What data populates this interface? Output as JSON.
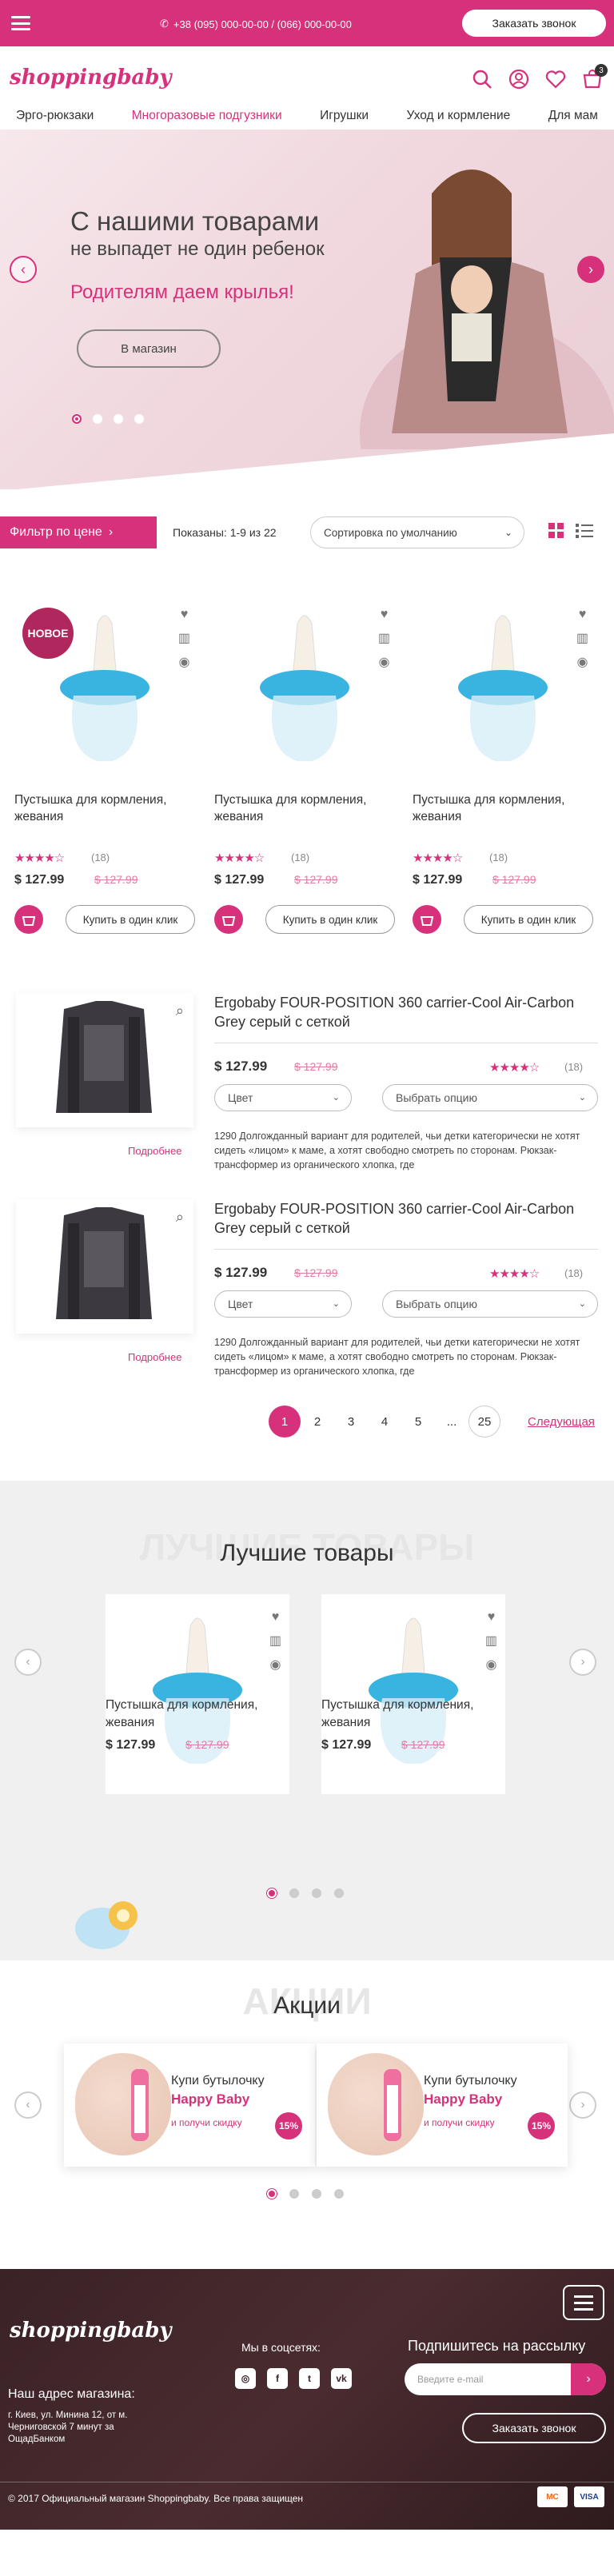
{
  "topbar": {
    "phones": "+38 (095) 000-00-00 / (066) 000-00-00",
    "call_button": "Заказать звонок"
  },
  "logo": "shoppingbaby",
  "header": {
    "cart_count": "3"
  },
  "nav": [
    "Эрго-рюкзаки",
    "Многоразовые подгузники",
    "Игрушки",
    "Уход и кормление",
    "Для мам"
  ],
  "hero": {
    "line1": "С нашими товарами",
    "line2": "не выпадет не один ребенок",
    "line3": "Родителям даем крылья!",
    "button": "В магазин"
  },
  "filter": {
    "button": "Фильтр по цене",
    "shown": "Показаны: 1-9 из 22",
    "sort": "Сортировка по умолчанию"
  },
  "products": [
    {
      "badge": "НОВОЕ",
      "name": "Пустышка для кормления, жевания",
      "stars": "★★★★☆",
      "count": "(18)",
      "price": "$ 127.99",
      "old": "$ 127.99",
      "buy": "Купить в один клик"
    },
    {
      "badge": "",
      "name": "Пустышка для кормления, жевания",
      "stars": "★★★★☆",
      "count": "(18)",
      "price": "$ 127.99",
      "old": "$ 127.99",
      "buy": "Купить в один клик"
    },
    {
      "badge": "",
      "name": "Пустышка для кормления, жевания",
      "stars": "★★★★☆",
      "count": "(18)",
      "price": "$ 127.99",
      "old": "$ 127.99",
      "buy": "Купить в один клик"
    }
  ],
  "list": [
    {
      "title": "Ergobaby FOUR-POSITION 360 carrier-Cool Air-Carbon Grey серый с сеткой",
      "price": "$ 127.99",
      "old": "$ 127.99",
      "stars": "★★★★☆",
      "count": "(18)",
      "color": "Цвет",
      "option": "Выбрать опцию",
      "desc": "1290 Долгожданный вариант для родителей, чьи детки категорически не хотят сидеть «лицом» к маме, а хотят свободно смотреть по сторонам. Рюкзак-трансформер из органического хлопка, где",
      "more": "Подробнее"
    },
    {
      "title": "Ergobaby FOUR-POSITION 360 carrier-Cool Air-Carbon Grey серый с сеткой",
      "price": "$ 127.99",
      "old": "$ 127.99",
      "stars": "★★★★☆",
      "count": "(18)",
      "color": "Цвет",
      "option": "Выбрать опцию",
      "desc": "1290 Долгожданный вариант для родителей, чьи детки категорически не хотят сидеть «лицом» к маме, а хотят свободно смотреть по сторонам. Рюкзак-трансформер из органического хлопка, где",
      "more": "Подробнее"
    }
  ],
  "pagination": {
    "pages": [
      "1",
      "2",
      "3",
      "4",
      "5",
      "...",
      "25"
    ],
    "next": "Следующая"
  },
  "best": {
    "ghost": "ЛУЧШИЕ ТОВАРЫ",
    "title": "Лучшие товары",
    "items": [
      {
        "name": "Пустышка для кормления, жевания",
        "price": "$ 127.99",
        "old": "$ 127.99"
      },
      {
        "name": "Пустышка для кормления, жевания",
        "price": "$ 127.99",
        "old": "$ 127.99"
      }
    ]
  },
  "sales": {
    "ghost": "АКЦИИ",
    "title": "Акции",
    "items": [
      {
        "l1": "Купи бутылочку",
        "l2": "Happy Baby",
        "l3": "и получи скидку",
        "pct": "15%"
      },
      {
        "l1": "Купи бутылочку",
        "l2": "Happy Baby",
        "l3": "и получи скидку",
        "pct": "15%"
      }
    ]
  },
  "footer": {
    "logo": "shoppingbaby",
    "addr_title": "Наш адрес магазина:",
    "addr": "г. Киев, ул. Минина 12, от м. Черниговской 7 минут за ОщадБанком",
    "social_title": "Мы в соцсетях:",
    "subscribe_title": "Подпишитесь на рассылку",
    "email_placeholder": "Введите e-mail",
    "call_button": "Заказать звонок",
    "copyright": "© 2017 Официальный магазин Shoppingbaby. Все права защищен",
    "cards": [
      "MC",
      "VISA"
    ]
  }
}
